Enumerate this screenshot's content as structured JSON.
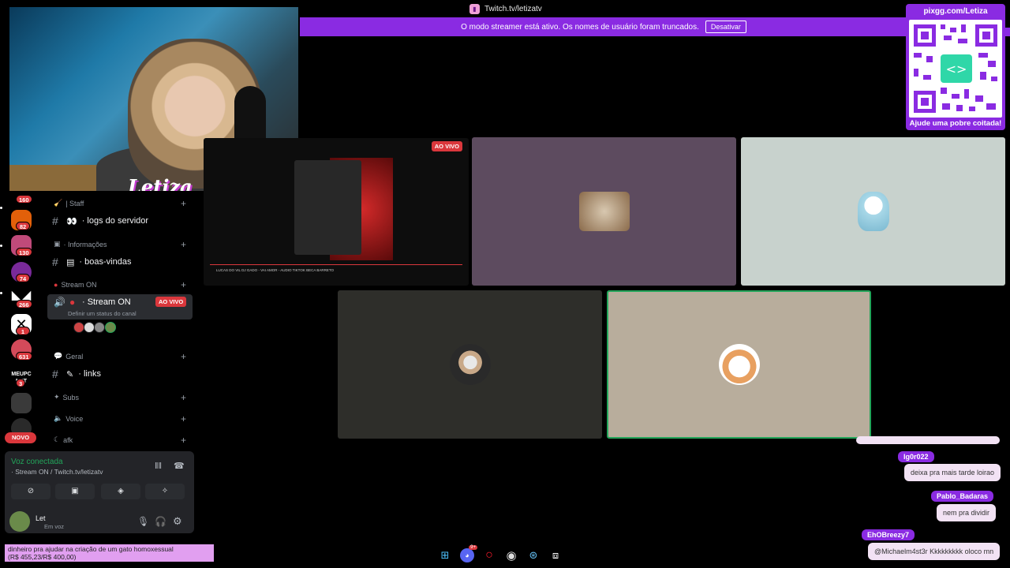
{
  "top_bar": {
    "url": "Twitch.tv/letizatv",
    "icon": "twitch-icon"
  },
  "streamer_banner": {
    "message": "O modo streamer está ativo. Os nomes de usuário foram truncados.",
    "disable_label": "Desativar"
  },
  "webcam": {
    "overlay_logo": "Letiza"
  },
  "qr_panel": {
    "title": "pixgg.com/Letiza",
    "footer": "Ajude uma pobre coitada!"
  },
  "server_rail": {
    "badges": [
      "160",
      "82",
      "130",
      "74",
      "266",
      "1",
      "631",
      "3"
    ],
    "text_icon": "MEUPC NET",
    "new_label": "NOVO"
  },
  "channels": {
    "staff_category": "| Staff",
    "logs_channel": "· logs do servidor",
    "info_category": "· Informações",
    "welcome_channel": "· boas-vindas",
    "stream_category": "Stream ON",
    "stream_channel": "· Stream ON",
    "live_badge": "AO VIVO",
    "channel_status": "Definir um status do canal",
    "general_category": "Geral",
    "links_channel": "· links",
    "subs_category": "Subs",
    "voice_category": "Voice",
    "afk_category": "afk"
  },
  "voice_panel": {
    "status": "Voz conectada",
    "location": "· Stream ON / Twitch.tv/letizatv",
    "username": "Let",
    "user_status": "Em voz"
  },
  "screen_share": {
    "live_badge": "AO VIVO",
    "video_title": "LUCAS DO VIL DJ GADO - VAI AMOR - AUDIO TIKTOK BECA BARRETO"
  },
  "chat": [
    {
      "user": "lg0r022",
      "message": "deixa pra mais tarde loirao"
    },
    {
      "user": "Pablo_Badaras",
      "message": "nem pra dividir"
    },
    {
      "user": "EhOBreezy7",
      "message": "@Michaelm4st3r Kkkkkkkkk oloco mn"
    }
  ],
  "donation": {
    "line1": "dinheiro pra ajudar na criação de um gato homoxessual",
    "line2": "(R$ 455,23/R$ 400,00)"
  },
  "taskbar": {
    "icons": [
      "windows-icon",
      "discord-icon",
      "opera-icon",
      "obs-icon",
      "steam-icon",
      "capcut-icon"
    ],
    "discord_badge": "9+"
  },
  "colors": {
    "twitch_purple": "#8a2be2",
    "discord_red": "#da373c",
    "voice_green": "#23a55a",
    "chat_bubble": "#f2e2f4"
  }
}
